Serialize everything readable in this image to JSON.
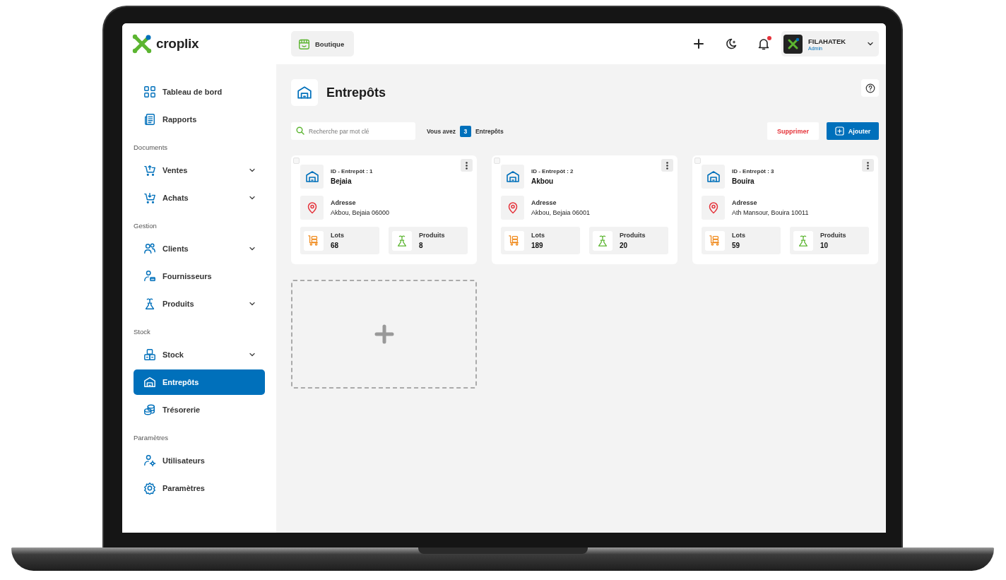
{
  "brand": {
    "name": "croplix"
  },
  "sidebar": {
    "groups": [
      {
        "items": [
          {
            "label": "Tableau de bord",
            "expandable": false,
            "selected": false
          },
          {
            "label": "Rapports",
            "expandable": false,
            "selected": false
          }
        ]
      },
      {
        "title": "Documents",
        "items": [
          {
            "label": "Ventes",
            "expandable": true,
            "selected": false
          },
          {
            "label": "Achats",
            "expandable": true,
            "selected": false
          }
        ]
      },
      {
        "title": "Gestion",
        "items": [
          {
            "label": "Clients",
            "expandable": true,
            "selected": false
          },
          {
            "label": "Fournisseurs",
            "expandable": false,
            "selected": false
          },
          {
            "label": "Produits",
            "expandable": true,
            "selected": false
          }
        ]
      },
      {
        "title": "Stock",
        "items": [
          {
            "label": "Stock",
            "expandable": true,
            "selected": false
          },
          {
            "label": "Entrepôts",
            "expandable": false,
            "selected": true
          },
          {
            "label": "Trésorerie",
            "expandable": false,
            "selected": false
          }
        ]
      },
      {
        "title": "Paramètres",
        "items": [
          {
            "label": "Utilisateurs",
            "expandable": false,
            "selected": false
          },
          {
            "label": "Paramètres",
            "expandable": false,
            "selected": false
          }
        ]
      }
    ]
  },
  "header": {
    "shop_button": "Boutique",
    "notifications": {
      "unread": true
    },
    "user": {
      "name": "FILAHATEK",
      "role": "Admin"
    }
  },
  "page": {
    "title": "Entrepôts"
  },
  "toolbar": {
    "search": {
      "placeholder": "Recherche par mot clé"
    },
    "count_prefix": "Vous avez",
    "count": "3",
    "count_suffix": "Entrepôts",
    "delete_button": "Supprimer",
    "add_button": "Ajouter"
  },
  "warehouses": [
    {
      "checked": false,
      "id_label": "ID - Entrepôt : 1",
      "name": "Bejaia",
      "address_label": "Adresse",
      "address": "Akbou, Bejaia 06000",
      "stats": [
        {
          "kind": "lots",
          "label": "Lots",
          "value": "68"
        },
        {
          "kind": "products",
          "label": "Produits",
          "value": "8"
        }
      ]
    },
    {
      "checked": false,
      "id_label": "ID - Entrepôt : 2",
      "name": "Akbou",
      "address_label": "Adresse",
      "address": "Akbou, Bejaia 06001",
      "stats": [
        {
          "kind": "lots",
          "label": "Lots",
          "value": "189"
        },
        {
          "kind": "products",
          "label": "Produits",
          "value": "20"
        }
      ]
    },
    {
      "checked": false,
      "id_label": "ID - Entrepôt : 3",
      "name": "Bouira",
      "address_label": "Adresse",
      "address": "Ath Mansour, Bouira 10011",
      "stats": [
        {
          "kind": "lots",
          "label": "Lots",
          "value": "59"
        },
        {
          "kind": "products",
          "label": "Produits",
          "value": "10"
        }
      ]
    }
  ]
}
